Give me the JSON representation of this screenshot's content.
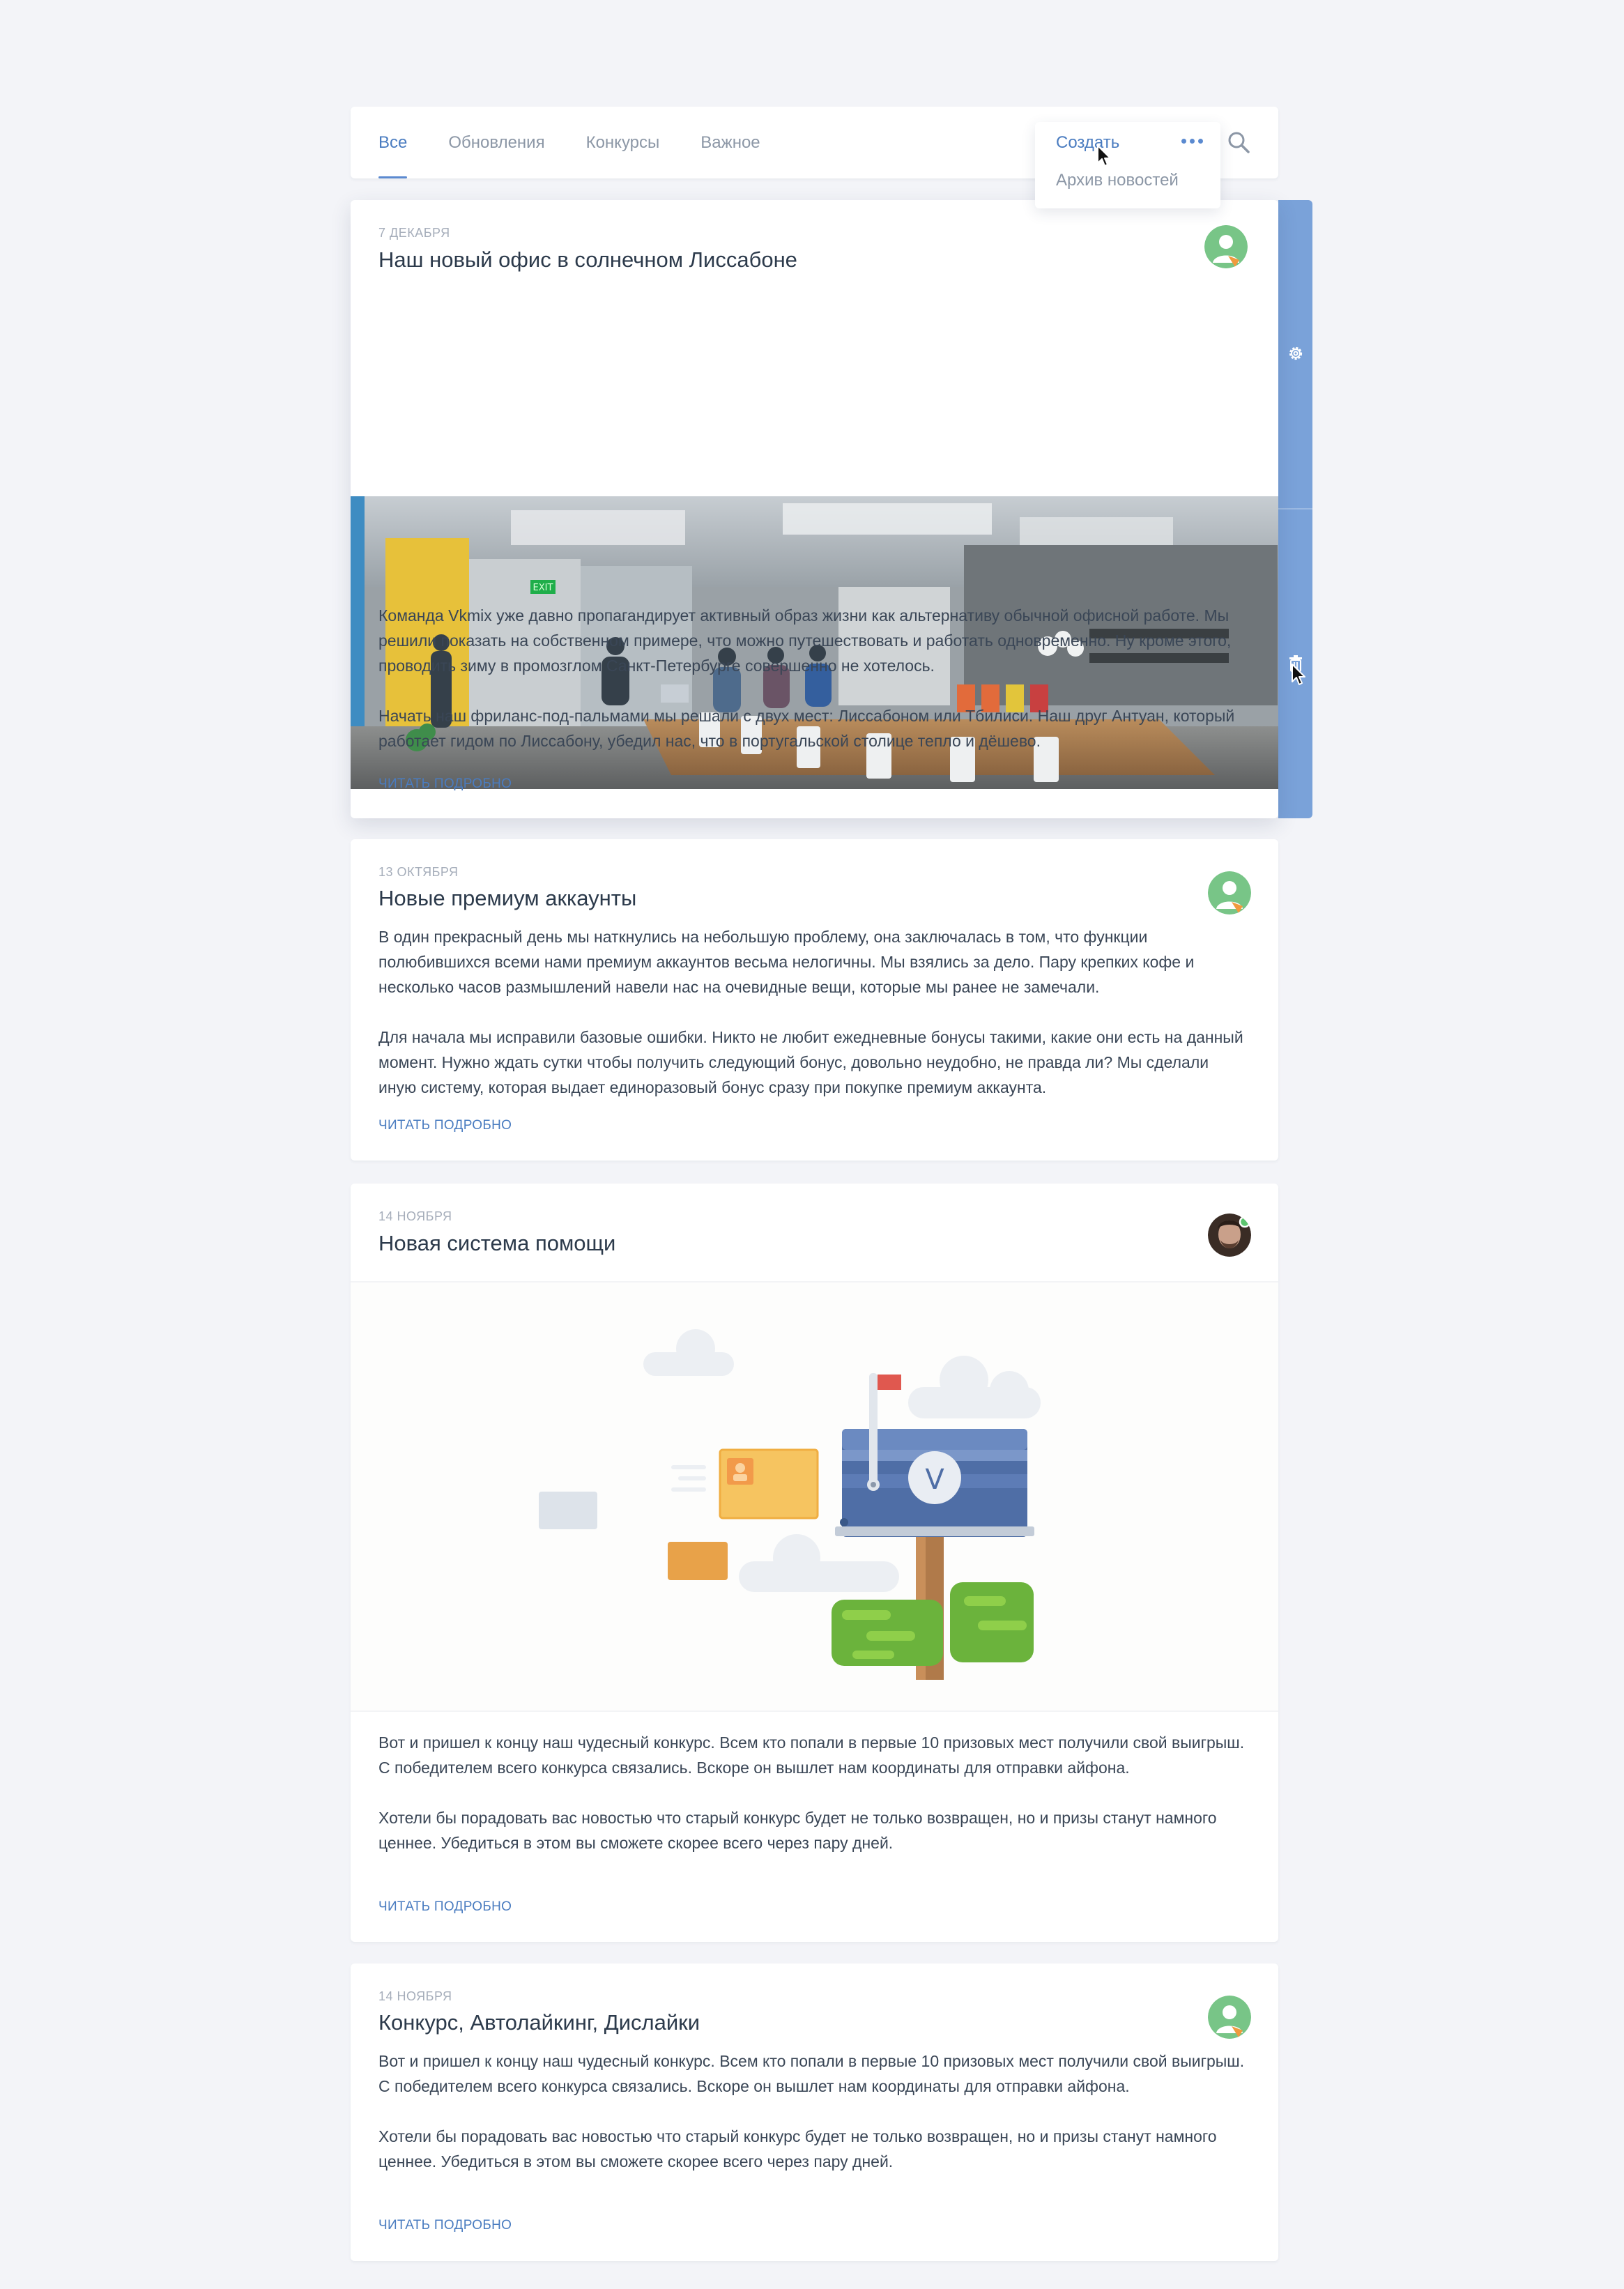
{
  "nav": {
    "tabs": [
      {
        "label": "Все"
      },
      {
        "label": "Обновления"
      },
      {
        "label": "Конкурсы"
      },
      {
        "label": "Важное"
      }
    ],
    "menu": {
      "create_label": "Создать",
      "archive_label": "Архив новостей"
    }
  },
  "posts": [
    {
      "date": "7 декабря",
      "title": "Наш новый офис в солнечном Лиссабоне",
      "paragraphs": [
        "Команда Vkmix уже давно пропагандирует активный образ жизни как альтернативу обычной офисной работе. Мы решили показать на собственном примере, что можно путешествовать и работать одновременно. Ну кроме этого, проводить зиму в промозглом Санкт-Петербурге совершенно не хотелось.",
        "Начать наш фриланс-под-пальмами мы решали с двух мест:  Лиссабоном или Тбилиси. Наш друг Антуан, который работает гидом по Лиссабону, убедил нас, что в португальской столице тепло и дёшево."
      ],
      "read_more": "Читать подробно",
      "exit_sign": "EXIT"
    },
    {
      "date": "13 октября",
      "title": "Новые премиум аккаунты",
      "paragraphs": [
        "В один прекрасный день мы наткнулись на небольшую проблему, она заключалась в том, что функции полюбившихся всеми нами премиум аккаунтов весьма нелогичны. Мы взялись за дело. Пару крепких кофе и несколько часов размышлений навели нас на очевидные вещи, которые мы ранее не замечали.",
        "Для начала мы исправили базовые ошибки. Никто не любит ежедневные бонусы такими, какие они есть на данный момент. Нужно ждать сутки чтобы получить следующий бонус, довольно неудобно, не правда ли? Мы сделали иную систему, которая выдает единоразовый бонус сразу при покупке премиум аккаунта."
      ],
      "read_more": "Читать подробно"
    },
    {
      "date": "14 ноября",
      "title": "Новая система помощи",
      "paragraphs": [
        "Вот и пришел к концу наш чудесный конкурс. Всем кто попали в первые 10 призовых мест получили свой выигрыш. С победителем всего конкурса связались. Вскоре он вышлет нам координаты для отправки айфона.",
        "Хотели бы порадовать вас новостью что старый конкурс будет не только возвращен, но и призы станут намного ценнее. Убедиться в этом вы сможете скорее всего через пару дней."
      ],
      "read_more": "Читать подробно",
      "mailbox_letter": "V"
    },
    {
      "date": "14 ноября",
      "title": "Конкурс, Автолайкинг, Дислайки",
      "paragraphs": [
        "Вот и пришел к концу наш чудесный конкурс. Всем кто попали в первые 10 призовых мест получили свой выигрыш. С победителем всего конкурса связались. Вскоре он вышлет нам координаты для отправки айфона.",
        "Хотели бы порадовать вас новостью что старый конкурс будет не только возвращен, но и призы станут намного ценнее. Убедиться в этом вы сможете скорее всего через пару дней."
      ],
      "read_more": "Читать подробно"
    }
  ],
  "colors": {
    "accent": "#4a7cc0",
    "sidebar": "#7aa2d9",
    "avatar_green": "#78c587",
    "avatar_orange": "#f09a3e"
  }
}
